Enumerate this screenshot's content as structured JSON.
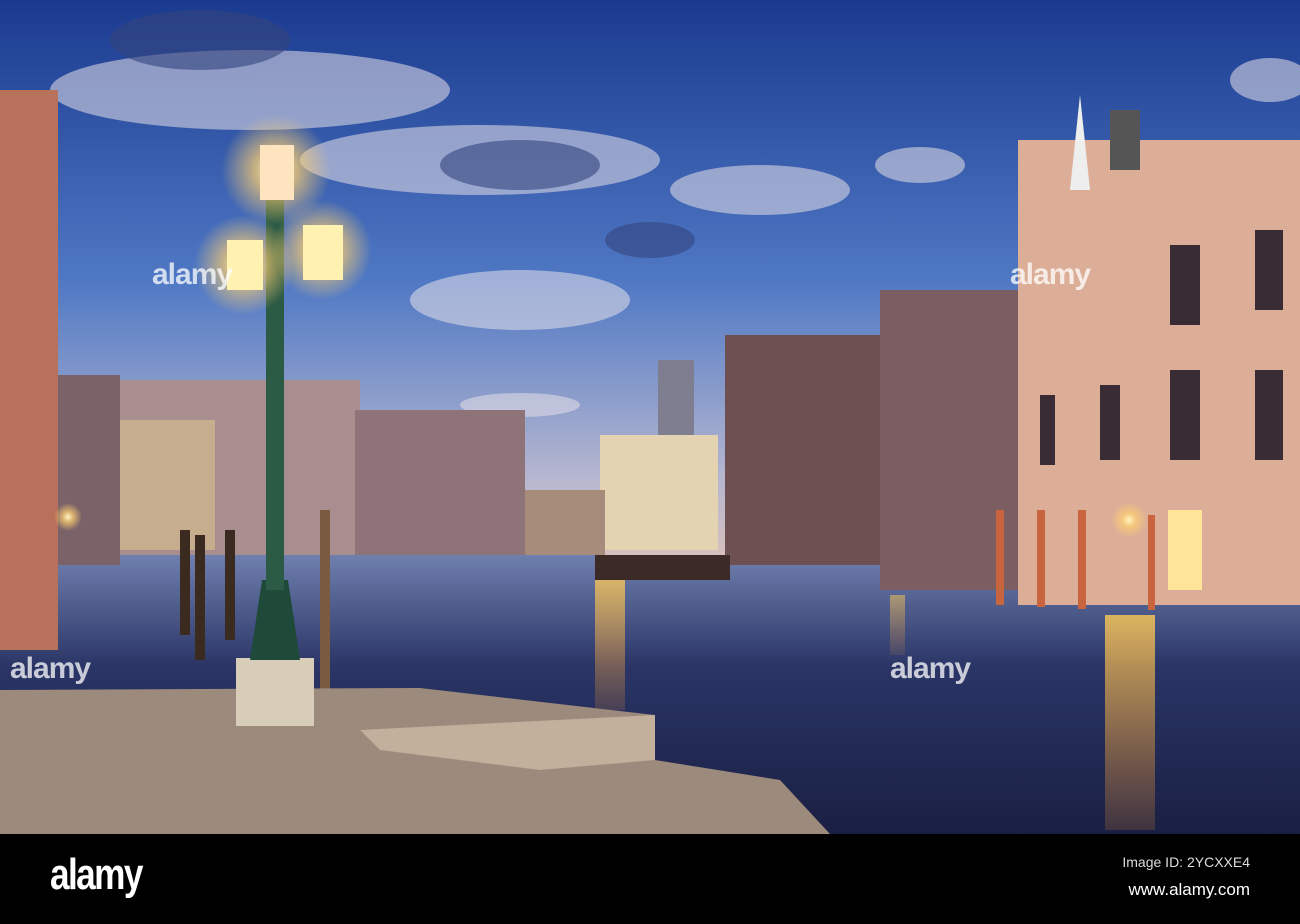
{
  "footer": {
    "logo": "alamy",
    "image_id": "Image ID: 2YCXXE4",
    "website": "www.alamy.com"
  },
  "watermark": "alamy",
  "colors": {
    "sky_top": "#1e3f93",
    "sky_horizon": "#c9b9c7",
    "water": "#1b2a55",
    "lamp_glow": "#ffd070"
  }
}
